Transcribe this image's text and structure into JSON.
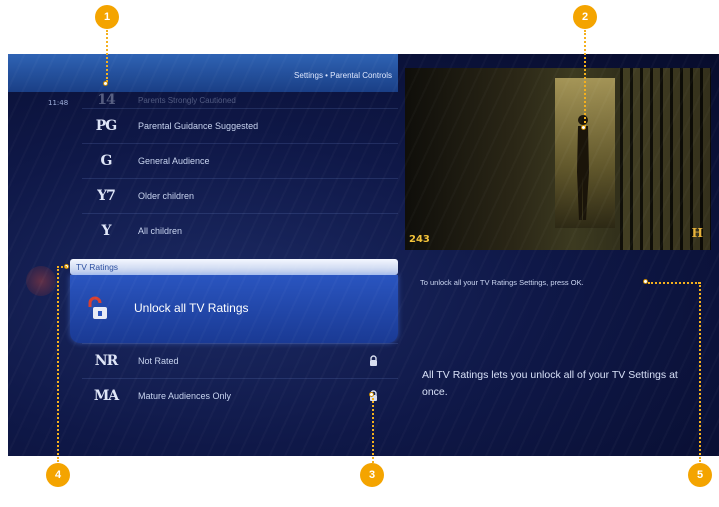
{
  "breadcrumb": "Settings • Parental Controls",
  "clock": "11:48",
  "ratings_top": [
    {
      "badge": "14",
      "label": "Parents Strongly Cautioned",
      "faded": true
    },
    {
      "badge": "PG",
      "label": "Parental Guidance Suggested"
    },
    {
      "badge": "G",
      "label": "General Audience"
    },
    {
      "badge": "Y7",
      "label": "Older children"
    },
    {
      "badge": "Y",
      "label": "All children"
    }
  ],
  "section_header": "TV Ratings",
  "selected_item": "Unlock all TV Ratings",
  "ratings_bottom": [
    {
      "badge": "NR",
      "label": "Not Rated",
      "locked": true
    },
    {
      "badge": "MA",
      "label": "Mature Audiences Only",
      "locked": true
    }
  ],
  "preview": {
    "channel": "243",
    "network_logo": "H"
  },
  "info_hint": "To unlock all your TV Ratings Settings, press OK.",
  "info_description": "All TV Ratings lets you unlock all of your TV Settings at once.",
  "callouts": [
    "1",
    "2",
    "3",
    "4",
    "5"
  ],
  "colors": {
    "accent": "#f4a400",
    "screen": "#0f1848",
    "highlight": "#2a55c0"
  },
  "icons": {
    "lock": "lock-icon",
    "unlock": "unlock-icon"
  }
}
